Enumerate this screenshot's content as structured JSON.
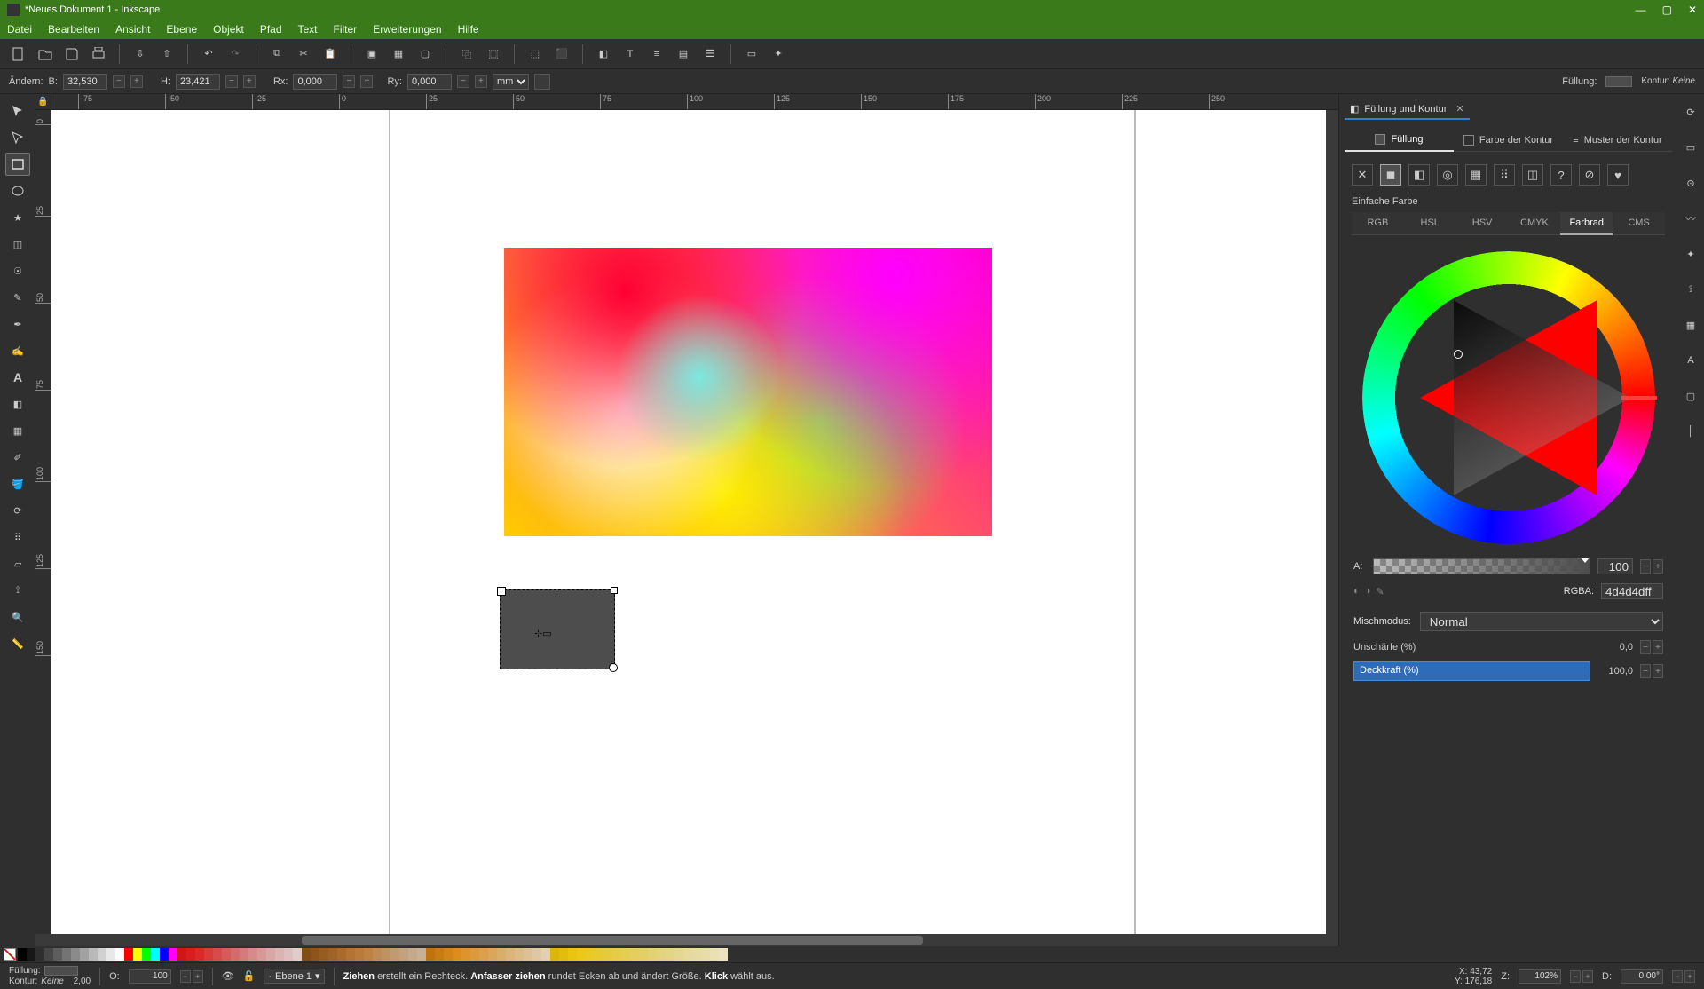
{
  "window": {
    "title": "*Neues Dokument 1 - Inkscape"
  },
  "menu": {
    "items": [
      "Datei",
      "Bearbeiten",
      "Ansicht",
      "Ebene",
      "Objekt",
      "Pfad",
      "Text",
      "Filter",
      "Erweiterungen",
      "Hilfe"
    ]
  },
  "tool_options": {
    "change_label": "Ändern:",
    "w_label": "B:",
    "w_value": "32,530",
    "h_label": "H:",
    "h_value": "23,421",
    "rx_label": "Rx:",
    "rx_value": "0,000",
    "ry_label": "Ry:",
    "ry_value": "0,000",
    "units": "mm",
    "fill_label": "Füllung:",
    "stroke_label": "Kontur:",
    "stroke_value": "Keine"
  },
  "ruler": {
    "h_ticks": [
      "-75",
      "-50",
      "-25",
      "0",
      "25",
      "50",
      "75",
      "100",
      "125",
      "150",
      "175",
      "200",
      "225",
      "250"
    ],
    "v_ticks": [
      "0",
      "25",
      "50",
      "75",
      "100",
      "125",
      "150"
    ]
  },
  "dock": {
    "panel_title": "Füllung und Kontur",
    "tabs": {
      "fill": "Füllung",
      "stroke_paint": "Farbe der Kontur",
      "stroke_style": "Muster der Kontur"
    },
    "flat_label": "Einfache Farbe",
    "color_tabs": [
      "RGB",
      "HSL",
      "HSV",
      "CMYK",
      "Farbrad",
      "CMS"
    ],
    "alpha_label": "A:",
    "alpha_value": "100",
    "rgba_label": "RGBA:",
    "rgba_value": "4d4d4dff",
    "blend_label": "Mischmodus:",
    "blend_value": "Normal",
    "blur_label": "Unschärfe (%)",
    "blur_value": "0,0",
    "opacity_label": "Deckkraft (%)",
    "opacity_value": "100,0"
  },
  "paint_type_icons": [
    "x-icon",
    "flat-fill-icon",
    "linear-gradient-icon",
    "radial-gradient-icon",
    "pattern-icon",
    "mesh-icon",
    "swatch-icon",
    "unknown-icon",
    "unset-icon",
    "heart-icon"
  ],
  "statusbar": {
    "fill_label": "Füllung:",
    "stroke_label": "Kontur:",
    "stroke_value": "Keine",
    "stroke_width": "2,00",
    "opacity_label": "O:",
    "opacity_value": "100",
    "layer_label": "Ebene 1",
    "hint_prefix": "Ziehen",
    "hint_mid1": " erstellt ein Rechteck. ",
    "hint_bold2": "Anfasser ziehen",
    "hint_mid2": " rundet Ecken ab und ändert Größe. ",
    "hint_bold3": "Klick",
    "hint_end": " wählt aus.",
    "x_label": "X:",
    "x_value": "43,72",
    "y_label": "Y:",
    "y_value": "176,18",
    "z_label": "Z:",
    "z_value": "102%",
    "d_label": "D:",
    "d_value": "0,00°"
  },
  "selected_fill_hex": "4d4d4d",
  "chart_data": null
}
